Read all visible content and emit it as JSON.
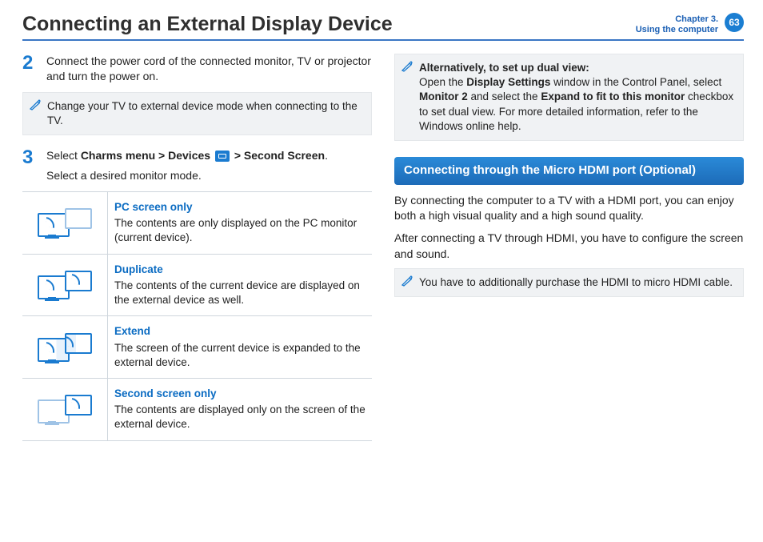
{
  "header": {
    "title": "Connecting an External Display Device",
    "chapter_line1": "Chapter 3.",
    "chapter_line2": "Using the computer",
    "page_number": "63"
  },
  "left": {
    "step2_num": "2",
    "step2_text": "Connect the power cord of the connected monitor, TV or projector and turn the power on.",
    "note1": "Change your TV to external device mode when connecting to the TV.",
    "step3_num": "3",
    "step3_prefix": "Select ",
    "step3_bold1": "Charms menu > Devices",
    "step3_mid": " ",
    "step3_bold2": "> Second Screen",
    "step3_suffix": ".",
    "step3_line2": "Select a desired monitor mode.",
    "modes": [
      {
        "title": "PC screen only",
        "desc": "The contents are only displayed on the PC monitor (current device)."
      },
      {
        "title": "Duplicate",
        "desc": "The contents of the current device are displayed on the external device as well."
      },
      {
        "title": "Extend",
        "desc": "The screen of the current device is expanded to the external device."
      },
      {
        "title": "Second screen only",
        "desc": "The contents are displayed only on the screen of the external device."
      }
    ]
  },
  "right": {
    "note2_title": "Alternatively, to set up dual view:",
    "note2_a": "Open the ",
    "note2_b1": "Display Settings",
    "note2_b": " window in the Control Panel, select ",
    "note2_b2": "Monitor 2",
    "note2_c": " and select the ",
    "note2_b3": "Expand to fit to this monitor",
    "note2_d": " checkbox to set dual view. For more detailed information, refer to the Windows online help.",
    "section_title": "Connecting through the Micro HDMI port (Optional)",
    "p1": "By connecting the computer to a TV with a HDMI port, you can enjoy both a high visual quality and a high sound quality.",
    "p2": "After connecting a TV through HDMI, you have to configure the screen and sound.",
    "note3": "You have to additionally purchase the HDMI to micro HDMI cable."
  }
}
